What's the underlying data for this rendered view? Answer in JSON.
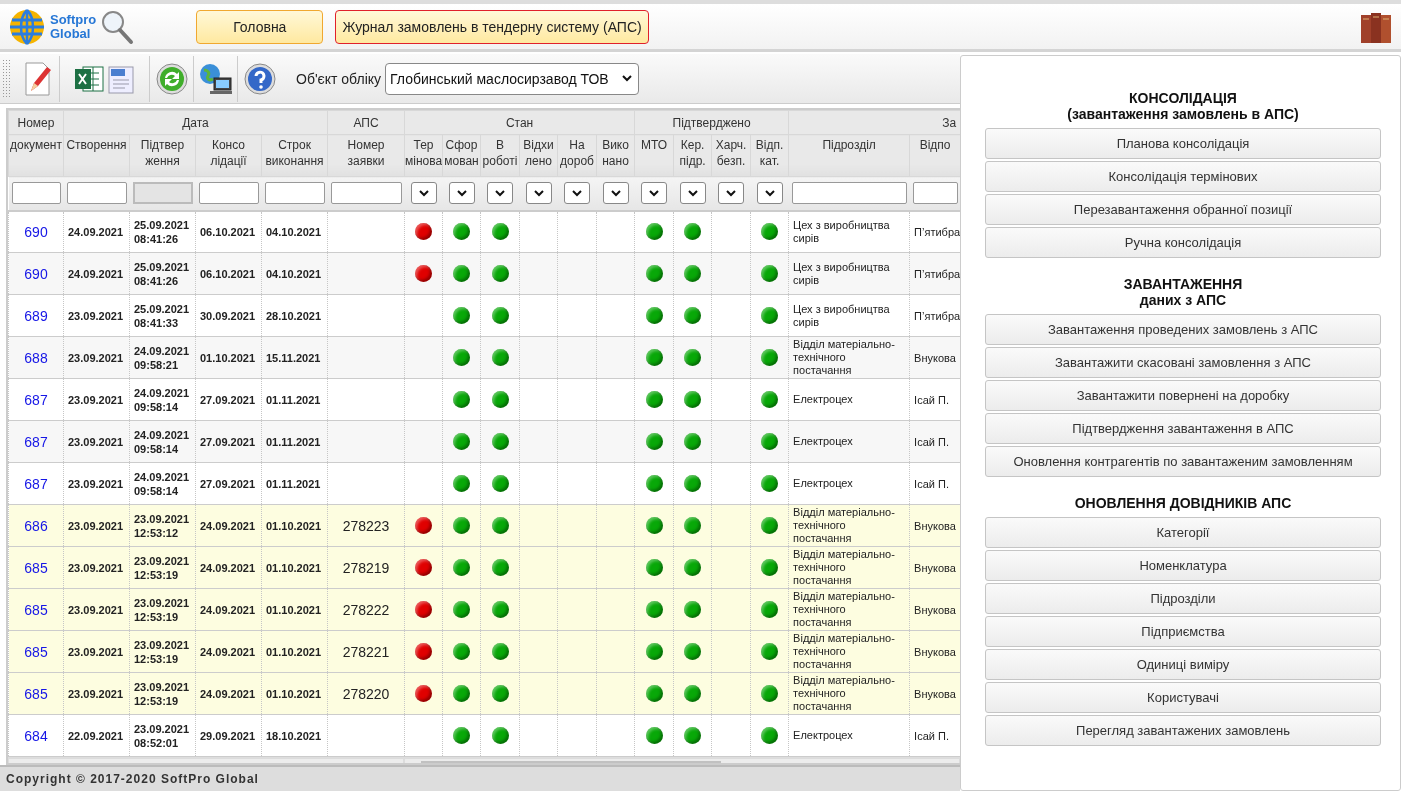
{
  "header": {
    "logo": {
      "line1": "Softpro",
      "line2": "Global"
    },
    "tabs": [
      {
        "label": "Головна",
        "selected": false
      },
      {
        "label": "Журнал замовлень в тендерну систему (АПС)",
        "selected": true
      }
    ]
  },
  "toolbar": {
    "account_label": "Об'єкт обліку",
    "account_value": "Глобинський маслосирзавод ТОВ"
  },
  "table": {
    "groups": [
      {
        "label": "Номер",
        "columns": [
          {
            "label": "документ",
            "kind": "number"
          }
        ]
      },
      {
        "label": "Дата",
        "columns": [
          {
            "label": "Створення",
            "kind": "created"
          },
          {
            "label": "Підтвер\nження",
            "kind": "confirmed"
          },
          {
            "label": "Консо\nлідації",
            "kind": "consolidated"
          },
          {
            "label": "Строк\nвиконання",
            "kind": "deadline"
          }
        ]
      },
      {
        "label": "АПС",
        "columns": [
          {
            "label": "Номер\nзаявки",
            "kind": "request"
          }
        ]
      },
      {
        "label": "Стан",
        "columns": [
          {
            "label": "Тер\nмінова",
            "kind": "alert"
          },
          {
            "label": "Сфор\nмован",
            "kind": "ok"
          },
          {
            "label": "В\nроботі",
            "kind": "ok"
          },
          {
            "label": "Відхи\nлено",
            "kind": "ok"
          },
          {
            "label": "На\nдороб",
            "kind": "ok"
          },
          {
            "label": "Вико\nнано",
            "kind": "ok"
          }
        ]
      },
      {
        "label": "Підтверджено",
        "columns": [
          {
            "label": "МТО",
            "kind": "ok"
          },
          {
            "label": "Кер.\nпідр.",
            "kind": "ok"
          },
          {
            "label": "Харч.\nбезп.",
            "kind": "ok"
          },
          {
            "label": "Відп.\nкат.",
            "kind": "ok"
          }
        ]
      },
      {
        "label": "За",
        "columns": [
          {
            "label": "Підрозділ",
            "kind": "department"
          },
          {
            "label": "Відпо",
            "kind": "responsible"
          }
        ]
      }
    ],
    "rows": [
      {
        "number": "690",
        "created": "24.09.2021",
        "confirmed": "25.09.2021\n08:41:26",
        "consolidated": "06.10.2021",
        "deadline": "04.10.2021",
        "marks": [
          true,
          true,
          true,
          false,
          false,
          false,
          true,
          true,
          false,
          true
        ],
        "department": "Цех з виробництва сирів",
        "responsible": "П’ятибра",
        "highlighted": false
      },
      {
        "number": "690",
        "created": "24.09.2021",
        "confirmed": "25.09.2021\n08:41:26",
        "consolidated": "06.10.2021",
        "deadline": "04.10.2021",
        "marks": [
          true,
          true,
          true,
          false,
          false,
          false,
          true,
          true,
          false,
          true
        ],
        "department": "Цех з виробництва сирів",
        "responsible": "П’ятибра",
        "highlighted": false
      },
      {
        "number": "689",
        "created": "23.09.2021",
        "confirmed": "25.09.2021\n08:41:33",
        "consolidated": "30.09.2021",
        "deadline": "28.10.2021",
        "marks": [
          false,
          true,
          true,
          false,
          false,
          false,
          true,
          true,
          false,
          true
        ],
        "department": "Цех з виробництва сирів",
        "responsible": "П’ятибра",
        "highlighted": false
      },
      {
        "number": "688",
        "created": "23.09.2021",
        "confirmed": "24.09.2021\n09:58:21",
        "consolidated": "01.10.2021",
        "deadline": "15.11.2021",
        "marks": [
          false,
          true,
          true,
          false,
          false,
          false,
          true,
          true,
          false,
          true
        ],
        "department": "Відділ матеріально-технічного постачання",
        "responsible": "Внукова",
        "highlighted": false
      },
      {
        "number": "687",
        "created": "23.09.2021",
        "confirmed": "24.09.2021\n09:58:14",
        "consolidated": "27.09.2021",
        "deadline": "01.11.2021",
        "marks": [
          false,
          true,
          true,
          false,
          false,
          false,
          true,
          true,
          false,
          true
        ],
        "department": "Електроцех",
        "responsible": "Ісай П.",
        "highlighted": false
      },
      {
        "number": "687",
        "created": "23.09.2021",
        "confirmed": "24.09.2021\n09:58:14",
        "consolidated": "27.09.2021",
        "deadline": "01.11.2021",
        "marks": [
          false,
          true,
          true,
          false,
          false,
          false,
          true,
          true,
          false,
          true
        ],
        "department": "Електроцех",
        "responsible": "Ісай П.",
        "highlighted": false
      },
      {
        "number": "687",
        "created": "23.09.2021",
        "confirmed": "24.09.2021\n09:58:14",
        "consolidated": "27.09.2021",
        "deadline": "01.11.2021",
        "marks": [
          false,
          true,
          true,
          false,
          false,
          false,
          true,
          true,
          false,
          true
        ],
        "department": "Електроцех",
        "responsible": "Ісай П.",
        "highlighted": false
      },
      {
        "number": "686",
        "created": "23.09.2021",
        "confirmed": "23.09.2021\n12:53:12",
        "consolidated": "24.09.2021",
        "deadline": "01.10.2021",
        "request": "278223",
        "marks": [
          true,
          true,
          true,
          false,
          false,
          false,
          true,
          true,
          false,
          true
        ],
        "department": "Відділ матеріально-технічного постачання",
        "responsible": "Внукова",
        "highlighted": true
      },
      {
        "number": "685",
        "created": "23.09.2021",
        "confirmed": "23.09.2021\n12:53:19",
        "consolidated": "24.09.2021",
        "deadline": "01.10.2021",
        "request": "278219",
        "marks": [
          true,
          true,
          true,
          false,
          false,
          false,
          true,
          true,
          false,
          true
        ],
        "department": "Відділ матеріально-технічного постачання",
        "responsible": "Внукова",
        "highlighted": true
      },
      {
        "number": "685",
        "created": "23.09.2021",
        "confirmed": "23.09.2021\n12:53:19",
        "consolidated": "24.09.2021",
        "deadline": "01.10.2021",
        "request": "278222",
        "marks": [
          true,
          true,
          true,
          false,
          false,
          false,
          true,
          true,
          false,
          true
        ],
        "department": "Відділ матеріально-технічного постачання",
        "responsible": "Внукова",
        "highlighted": true
      },
      {
        "number": "685",
        "created": "23.09.2021",
        "confirmed": "23.09.2021\n12:53:19",
        "consolidated": "24.09.2021",
        "deadline": "01.10.2021",
        "request": "278221",
        "marks": [
          true,
          true,
          true,
          false,
          false,
          false,
          true,
          true,
          false,
          true
        ],
        "department": "Відділ матеріально-технічного постачання",
        "responsible": "Внукова",
        "highlighted": true
      },
      {
        "number": "685",
        "created": "23.09.2021",
        "confirmed": "23.09.2021\n12:53:19",
        "consolidated": "24.09.2021",
        "deadline": "01.10.2021",
        "request": "278220",
        "marks": [
          true,
          true,
          true,
          false,
          false,
          false,
          true,
          true,
          false,
          true
        ],
        "department": "Відділ матеріально-технічного постачання",
        "responsible": "Внукова",
        "highlighted": true
      },
      {
        "number": "684",
        "created": "22.09.2021",
        "confirmed": "23.09.2021\n08:52:01",
        "consolidated": "29.09.2021",
        "deadline": "18.10.2021",
        "marks": [
          false,
          true,
          true,
          false,
          false,
          false,
          true,
          true,
          false,
          true
        ],
        "department": "Електроцех",
        "responsible": "Ісай П.",
        "highlighted": false
      }
    ]
  },
  "side_panel": {
    "sections": [
      {
        "title": "КОНСОЛІДАЦІЯ",
        "subtitle": "(завантаження замовлень в АПС)",
        "buttons": [
          "Планова консолідація",
          "Консолідація термінових",
          "Перезавантаження обранної позиції",
          "Ручна консолідація"
        ]
      },
      {
        "title": "ЗАВАНТАЖЕННЯ",
        "subtitle": "даних з АПС",
        "buttons": [
          "Завантаження проведених замовлень з АПС",
          "Завантажити скасовані замовлення з АПС",
          "Завантажити повернені на доробку",
          "Підтвердження завантаження в АПС",
          "Оновлення контрагентів по завантаженим замовленням"
        ]
      },
      {
        "title": "ОНОВЛЕННЯ ДОВІДНИКІВ АПС",
        "buttons": [
          "Категорії",
          "Номенклатура",
          "Підрозділи",
          "Підприємства",
          "Одиниці виміру",
          "Користувачі",
          "Перегляд завантажених замовлень"
        ]
      }
    ]
  },
  "footer": {
    "copyright": "Copyright © 2017-2020 SoftPro Global"
  }
}
